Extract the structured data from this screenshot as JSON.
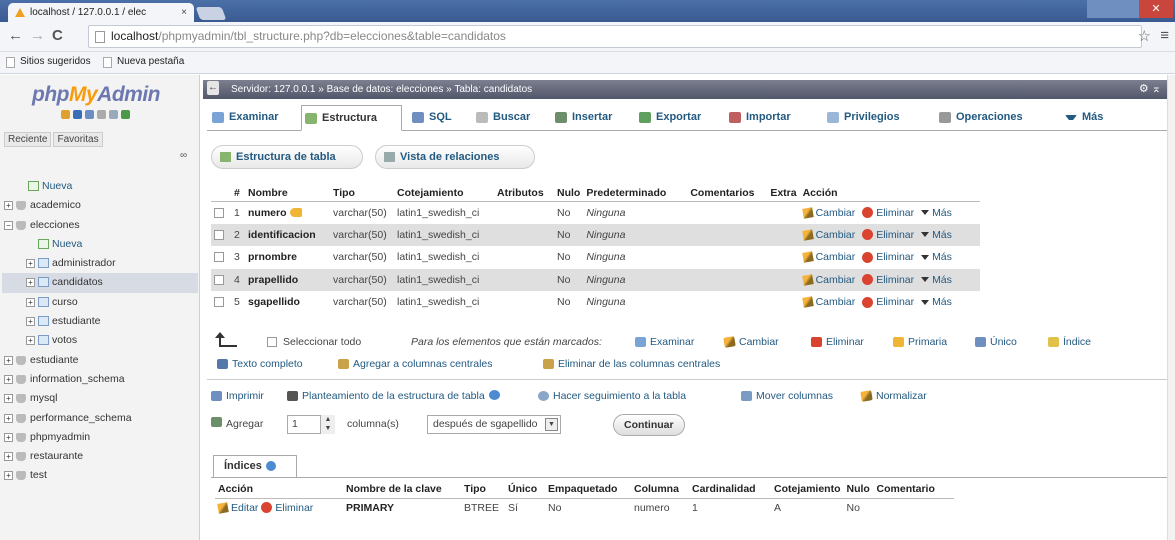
{
  "browser": {
    "tab_title": "localhost / 127.0.0.1 / elec",
    "tab_close": "×",
    "url_host": "localhost",
    "url_path": "/phpmyadmin/tbl_structure.php?db=elecciones&table=candidatos",
    "bookmarks": [
      "Sitios sugeridos",
      "Nueva pestaña"
    ]
  },
  "sidebar": {
    "logo": {
      "php": "php",
      "my": "My",
      "admin": "Admin"
    },
    "tabs": [
      "Reciente",
      "Favoritas"
    ],
    "tree": [
      {
        "label": "Nueva",
        "type": "new",
        "level": 1
      },
      {
        "label": "academico",
        "type": "db",
        "level": 0
      },
      {
        "label": "elecciones",
        "type": "db",
        "level": 0
      },
      {
        "label": "Nueva",
        "type": "new",
        "level": 2
      },
      {
        "label": "administrador",
        "type": "table",
        "level": 2
      },
      {
        "label": "candidatos",
        "type": "table",
        "level": 2
      },
      {
        "label": "curso",
        "type": "table",
        "level": 2
      },
      {
        "label": "estudiante",
        "type": "table",
        "level": 2
      },
      {
        "label": "votos",
        "type": "table",
        "level": 2
      },
      {
        "label": "estudiante",
        "type": "db",
        "level": 0
      },
      {
        "label": "information_schema",
        "type": "db",
        "level": 0
      },
      {
        "label": "mysql",
        "type": "db",
        "level": 0
      },
      {
        "label": "performance_schema",
        "type": "db",
        "level": 0
      },
      {
        "label": "phpmyadmin",
        "type": "db",
        "level": 0
      },
      {
        "label": "restaurante",
        "type": "db",
        "level": 0
      },
      {
        "label": "test",
        "type": "db",
        "level": 0
      }
    ]
  },
  "breadcrumb": {
    "server": "Servidor: 127.0.0.1",
    "database": "Base de datos: elecciones",
    "table": "Tabla: candidatos"
  },
  "tabs": [
    "Examinar",
    "Estructura",
    "SQL",
    "Buscar",
    "Insertar",
    "Exportar",
    "Importar",
    "Privilegios",
    "Operaciones",
    "Más"
  ],
  "subtabs": [
    "Estructura de tabla",
    "Vista de relaciones"
  ],
  "structure": {
    "headers": [
      "#",
      "Nombre",
      "Tipo",
      "Cotejamiento",
      "Atributos",
      "Nulo",
      "Predeterminado",
      "Comentarios",
      "Extra",
      "Acción"
    ],
    "rows": [
      {
        "n": "1",
        "name": "numero",
        "type": "varchar(50)",
        "collation": "latin1_swedish_ci",
        "attributes": "",
        "null": "No",
        "default": "Ninguna",
        "comments": "",
        "extra": ""
      },
      {
        "n": "2",
        "name": "identificacion",
        "type": "varchar(50)",
        "collation": "latin1_swedish_ci",
        "attributes": "",
        "null": "No",
        "default": "Ninguna",
        "comments": "",
        "extra": ""
      },
      {
        "n": "3",
        "name": "prnombre",
        "type": "varchar(50)",
        "collation": "latin1_swedish_ci",
        "attributes": "",
        "null": "No",
        "default": "Ninguna",
        "comments": "",
        "extra": ""
      },
      {
        "n": "4",
        "name": "prapellido",
        "type": "varchar(50)",
        "collation": "latin1_swedish_ci",
        "attributes": "",
        "null": "No",
        "default": "Ninguna",
        "comments": "",
        "extra": ""
      },
      {
        "n": "5",
        "name": "sgapellido",
        "type": "varchar(50)",
        "collation": "latin1_swedish_ci",
        "attributes": "",
        "null": "No",
        "default": "Ninguna",
        "comments": "",
        "extra": ""
      }
    ],
    "row_actions": {
      "change": "Cambiar",
      "drop": "Eliminar",
      "more": "Más"
    }
  },
  "bulk": {
    "select_all": "Seleccionar todo",
    "with_selected": "Para los elementos que están marcados:",
    "actions": [
      "Examinar",
      "Cambiar",
      "Eliminar",
      "Primaria",
      "Único",
      "Índice"
    ],
    "fulltext": "Texto completo",
    "add_central": "Agregar a columnas centrales",
    "remove_central": "Eliminar de las columnas centrales"
  },
  "actions2": [
    "Imprimir",
    "Planteamiento de la estructura de tabla",
    "Hacer seguimiento a la tabla",
    "Mover columnas",
    "Normalizar"
  ],
  "add_columns": {
    "label": "Agregar",
    "count": "1",
    "unit": "columna(s)",
    "position": "después de sgapellido",
    "button": "Continuar"
  },
  "indexes": {
    "title": "Índices",
    "headers": [
      "Acción",
      "Nombre de la clave",
      "Tipo",
      "Único",
      "Empaquetado",
      "Columna",
      "Cardinalidad",
      "Cotejamiento",
      "Nulo",
      "Comentario"
    ],
    "row": {
      "edit": "Editar",
      "drop": "Eliminar",
      "key": "PRIMARY",
      "type": "BTREE",
      "unique": "Sí",
      "packed": "No",
      "column": "numero",
      "cardinality": "1",
      "collation": "A",
      "null": "No",
      "comment": ""
    }
  }
}
